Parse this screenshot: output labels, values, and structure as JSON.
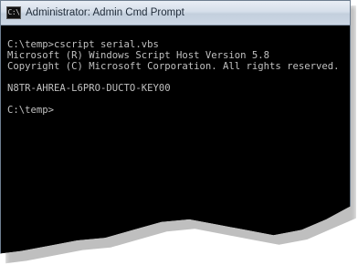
{
  "window": {
    "title": "Administrator: Admin Cmd Prompt",
    "icon": "cmd-icon",
    "icon_glyph": "C:\\"
  },
  "console": {
    "lines": [
      "C:\\temp>cscript serial.vbs",
      "Microsoft (R) Windows Script Host Version 5.8",
      "Copyright (C) Microsoft Corporation. All rights reserved.",
      "",
      "N8TR-AHREA-L6PRO-DUCTO-KEY00",
      "",
      "C:\\temp>"
    ]
  },
  "colors": {
    "console_background": "#000000",
    "console_text": "#c0c0c0",
    "titlebar": "#d6dfea"
  }
}
